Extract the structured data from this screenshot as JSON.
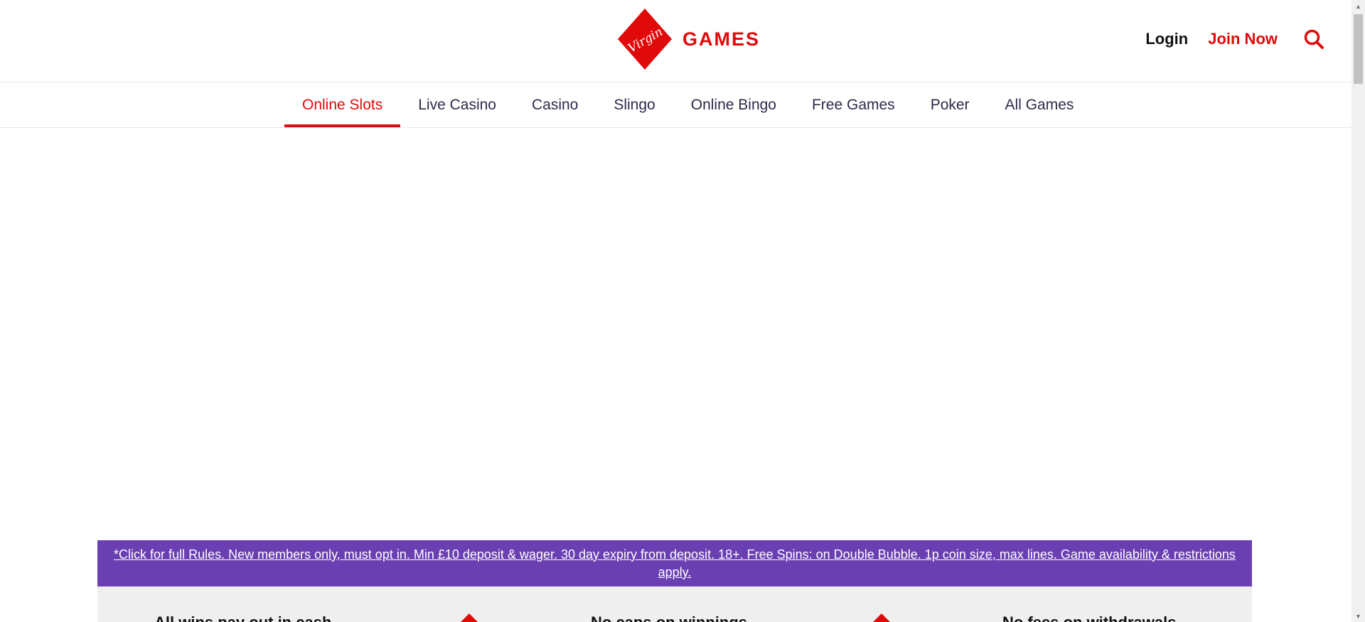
{
  "brand": {
    "logo_word": "Virgin",
    "name": "GAMES",
    "accent_color": "#e10a0a"
  },
  "header": {
    "login_label": "Login",
    "join_label": "Join Now",
    "search_icon": "search-icon"
  },
  "nav": {
    "items": [
      {
        "label": "Online Slots",
        "active": true
      },
      {
        "label": "Live Casino"
      },
      {
        "label": "Casino"
      },
      {
        "label": "Slingo"
      },
      {
        "label": "Online Bingo"
      },
      {
        "label": "Free Games"
      },
      {
        "label": "Poker"
      },
      {
        "label": "All Games"
      }
    ]
  },
  "promo": {
    "text": "*Click for full Rules. New members only, must opt in. Min £10 deposit & wager. 30 day expiry from deposit. 18+. Free Spins: on Double Bubble. 1p coin size, max lines. Game availability & restrictions apply.",
    "background": "#6a3fb2"
  },
  "usps": [
    {
      "text": "All wins pay out in cash"
    },
    {
      "text": "No caps on winnings"
    },
    {
      "text": "No fees on withdrawals"
    }
  ]
}
